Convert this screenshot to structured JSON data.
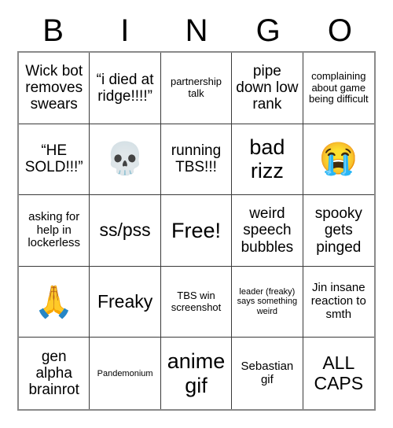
{
  "card": {
    "title_letters": [
      "B",
      "I",
      "N",
      "G",
      "O"
    ],
    "rows": [
      [
        {
          "text": "Wick bot removes swears",
          "size": "md",
          "kind": "text"
        },
        {
          "text": "“i died at ridge!!!!”",
          "size": "md",
          "kind": "text"
        },
        {
          "text": "partnership talk",
          "size": "xs",
          "kind": "text"
        },
        {
          "text": "pipe down low rank",
          "size": "md",
          "kind": "text"
        },
        {
          "text": "complaining about game being difficult",
          "size": "xs",
          "kind": "text"
        }
      ],
      [
        {
          "text": "“HE SOLD!!!”",
          "size": "md",
          "kind": "text"
        },
        {
          "text": "💀",
          "size": "md",
          "kind": "emoji",
          "icon": "skull-emoji"
        },
        {
          "text": "running TBS!!!",
          "size": "md",
          "kind": "text"
        },
        {
          "text": "bad rizz",
          "size": "xl",
          "kind": "text"
        },
        {
          "text": "😭",
          "size": "md",
          "kind": "emoji",
          "icon": "loudly-crying-face-emoji"
        }
      ],
      [
        {
          "text": "asking for help in lockerless",
          "size": "sm",
          "kind": "text"
        },
        {
          "text": "ss/pss",
          "size": "lg",
          "kind": "text"
        },
        {
          "text": "Free!",
          "size": "xl",
          "kind": "text"
        },
        {
          "text": "weird speech bubbles",
          "size": "md",
          "kind": "text"
        },
        {
          "text": "spooky gets pinged",
          "size": "md",
          "kind": "text"
        }
      ],
      [
        {
          "text": "🙏",
          "size": "md",
          "kind": "emoji",
          "icon": "folded-hands-emoji"
        },
        {
          "text": "Freaky",
          "size": "lg",
          "kind": "text"
        },
        {
          "text": "TBS win screenshot",
          "size": "xs",
          "kind": "text"
        },
        {
          "text": "leader (freaky) says something weird",
          "size": "xxs",
          "kind": "text"
        },
        {
          "text": "Jin insane reaction to smth",
          "size": "sm",
          "kind": "text"
        }
      ],
      [
        {
          "text": "gen alpha brainrot",
          "size": "md",
          "kind": "text"
        },
        {
          "text": "Pandemonium",
          "size": "xxs",
          "kind": "text"
        },
        {
          "text": "anime gif",
          "size": "xl",
          "kind": "text"
        },
        {
          "text": "Sebastian gif",
          "size": "sm",
          "kind": "text"
        },
        {
          "text": "ALL CAPS",
          "size": "lg",
          "kind": "text"
        }
      ]
    ]
  },
  "colors": {
    "background": "#ffffff",
    "text": "#000000",
    "cell_border": "#3a3a3a",
    "outer_border": "#8a8a8a"
  }
}
